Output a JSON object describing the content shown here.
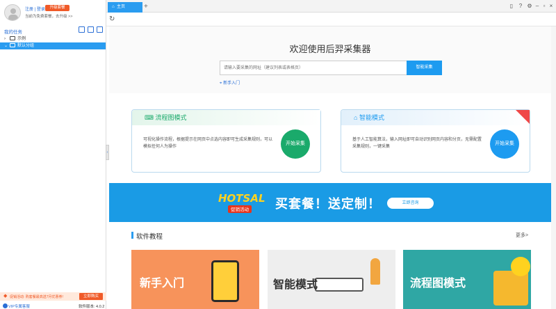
{
  "account": {
    "login_label": "注册 | 登录",
    "upgrade_label": "升级套餐",
    "status_text": "当前为免费套餐，去升级 >>"
  },
  "sidebar": {
    "tasks_heading": "我的任务",
    "tree": [
      {
        "label": "示例"
      },
      {
        "label": "默认分组"
      }
    ],
    "promo_text": "促销活动: 购套餐最高送7月优惠券!",
    "promo_button": "立即购买",
    "vip_support": "VIP专属客服",
    "version": "软件版本: 4.0.2"
  },
  "tabs": {
    "home": "主页"
  },
  "hero": {
    "title": "欢迎使用后羿采集器",
    "search_placeholder": "请输入要采集的网址（建议列表或表格页）",
    "search_button": "智能采集",
    "guide_link": "新手入门"
  },
  "modes": [
    {
      "title": "流程图模式",
      "description": "可视化操作流程，根据提示在网页中点选内容即可生成采集规则，可以模拟任何人为操作",
      "button": "开始采集"
    },
    {
      "title": "智能模式",
      "description": "基于人工智能算法，输入网址即可自动识别网页内容和分页，无需配置采集规则，一键采集",
      "button": "开始采集"
    }
  ],
  "banner": {
    "logo_text": "HOTSALE",
    "logo_sub": "促销活动",
    "title": "买套餐！送定制！",
    "button": "立即咨询"
  },
  "tutorials": {
    "heading": "软件教程",
    "more": "更多>",
    "cards": [
      {
        "title": "新手入门",
        "color": "#f7935b"
      },
      {
        "title": "智能模式",
        "color": "#eeeeee"
      },
      {
        "title": "流程图模式",
        "color": "#2fa7a4"
      }
    ]
  },
  "colors": {
    "accent": "#2a9cf0",
    "brand_orange": "#f05a28",
    "flow_green": "#1aaa6b",
    "smart_blue": "#1d9bf0"
  }
}
